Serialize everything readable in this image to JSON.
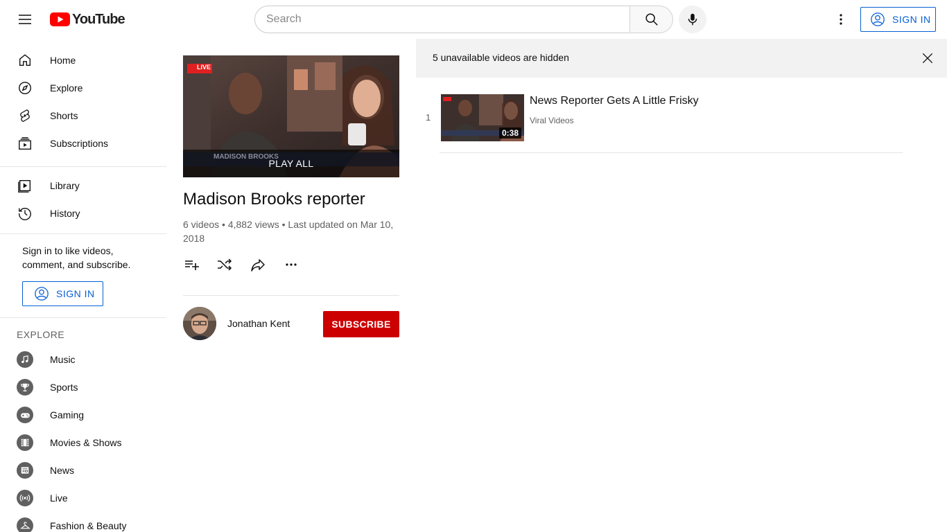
{
  "header": {
    "logo_text": "YouTube",
    "search_placeholder": "Search",
    "signin_label": "SIGN IN"
  },
  "sidebar": {
    "main": [
      {
        "label": "Home",
        "icon": "home-icon"
      },
      {
        "label": "Explore",
        "icon": "compass-icon"
      },
      {
        "label": "Shorts",
        "icon": "shorts-icon"
      },
      {
        "label": "Subscriptions",
        "icon": "subscriptions-icon"
      }
    ],
    "library": [
      {
        "label": "Library",
        "icon": "library-icon"
      },
      {
        "label": "History",
        "icon": "history-icon"
      }
    ],
    "signin_message": "Sign in to like videos, comment, and subscribe.",
    "signin_label": "SIGN IN",
    "explore_title": "EXPLORE",
    "explore": [
      {
        "label": "Music",
        "icon": "music-icon"
      },
      {
        "label": "Sports",
        "icon": "trophy-icon"
      },
      {
        "label": "Gaming",
        "icon": "gamepad-icon"
      },
      {
        "label": "Movies & Shows",
        "icon": "film-icon"
      },
      {
        "label": "News",
        "icon": "news-icon"
      },
      {
        "label": "Live",
        "icon": "live-icon"
      },
      {
        "label": "Fashion & Beauty",
        "icon": "hanger-icon"
      }
    ]
  },
  "playlist": {
    "thumbnail_badge": "LIVE",
    "thumbnail_caption": "MADISON BROOKS",
    "play_all_label": "PLAY ALL",
    "title": "Madison Brooks reporter",
    "stats": "6 videos • 4,882 views • Last updated on Mar 10, 2018",
    "owner_name": "Jonathan Kent",
    "subscribe_label": "SUBSCRIBE"
  },
  "alert": {
    "text": "5 unavailable videos are hidden"
  },
  "videos": [
    {
      "index": "1",
      "title": "News Reporter Gets A Little Frisky",
      "channel": "Viral Videos",
      "duration": "0:38"
    }
  ],
  "colors": {
    "brand_red": "#ff0000",
    "subscribe_red": "#cc0000",
    "link_blue": "#065fd4"
  }
}
